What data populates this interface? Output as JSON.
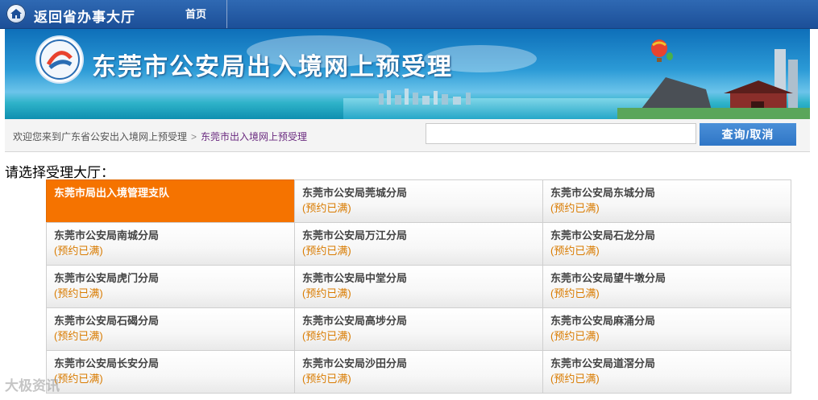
{
  "topbar": {
    "back_label": "返回省办事大厅",
    "home_label": "首页"
  },
  "banner": {
    "title": "东莞市公安局出入境网上预受理"
  },
  "breadcrumb": {
    "root": "欢迎您来到广东省公安出入境网上预受理",
    "separator": ">",
    "current": "东莞市出入境网上预受理"
  },
  "search": {
    "value": "",
    "button_label": "查询/取消"
  },
  "section": {
    "title": "请选择受理大厅："
  },
  "halls": [
    {
      "name": "东莞市局出入境管理支队",
      "status": "",
      "active": true
    },
    {
      "name": "东莞市公安局莞城分局",
      "status": "(预约已满)",
      "active": false
    },
    {
      "name": "东莞市公安局东城分局",
      "status": "(预约已满)",
      "active": false
    },
    {
      "name": "东莞市公安局南城分局",
      "status": "(预约已满)",
      "active": false
    },
    {
      "name": "东莞市公安局万江分局",
      "status": "(预约已满)",
      "active": false
    },
    {
      "name": "东莞市公安局石龙分局",
      "status": "(预约已满)",
      "active": false
    },
    {
      "name": "东莞市公安局虎门分局",
      "status": "(预约已满)",
      "active": false
    },
    {
      "name": "东莞市公安局中堂分局",
      "status": "(预约已满)",
      "active": false
    },
    {
      "name": "东莞市公安局望牛墩分局",
      "status": "(预约已满)",
      "active": false
    },
    {
      "name": "东莞市公安局石碣分局",
      "status": "(预约已满)",
      "active": false
    },
    {
      "name": "东莞市公安局高埗分局",
      "status": "(预约已满)",
      "active": false
    },
    {
      "name": "东莞市公安局麻涌分局",
      "status": "(预约已满)",
      "active": false
    },
    {
      "name": "东莞市公安局长安分局",
      "status": "(预约已满)",
      "active": false
    },
    {
      "name": "东莞市公安局沙田分局",
      "status": "(预约已满)",
      "active": false
    },
    {
      "name": "东莞市公安局道滘分局",
      "status": "(预约已满)",
      "active": false
    }
  ],
  "watermark": {
    "text": "大极资讯"
  },
  "colors": {
    "active_hall": "#f57300",
    "status_text": "#d97b00",
    "topbar": "#2a60aa"
  }
}
